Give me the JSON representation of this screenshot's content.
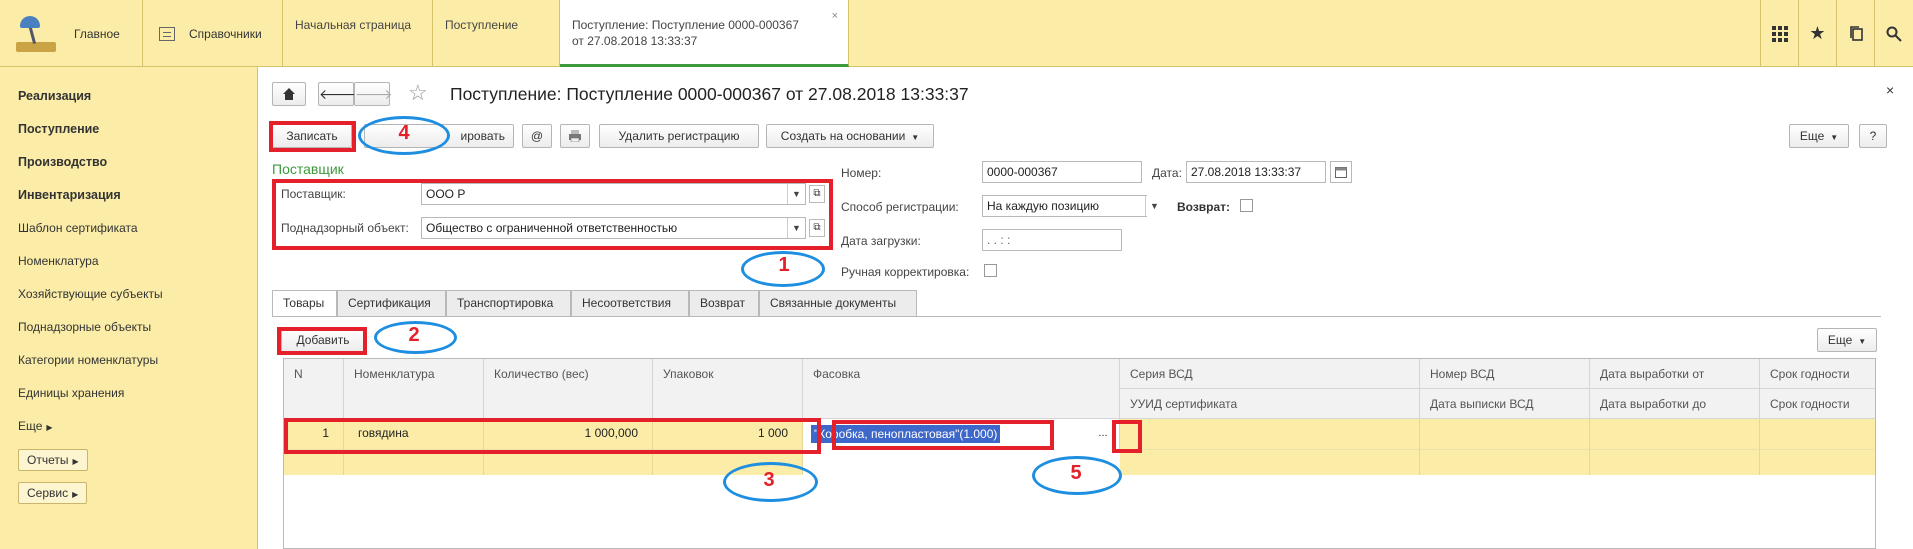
{
  "topbar": {
    "home_label": "Главное",
    "catalogs_label": "Справочники",
    "tabs": [
      {
        "label": "Начальная страница"
      },
      {
        "label": "Поступление"
      },
      {
        "label_line1": "Поступление: Поступление 0000-000367",
        "label_line2": "от 27.08.2018 13:33:37",
        "close": "×"
      }
    ],
    "icons": {
      "apps": "grid-icon",
      "favorites": "star-icon",
      "history": "copy-icon",
      "search": "search-icon"
    }
  },
  "sidebar": {
    "items": [
      {
        "label": "Реализация",
        "bold": true
      },
      {
        "label": "Поступление",
        "bold": true
      },
      {
        "label": "Производство",
        "bold": true
      },
      {
        "label": "Инвентаризация",
        "bold": true
      },
      {
        "label": "Шаблон сертификата"
      },
      {
        "label": "Номенклатура"
      },
      {
        "label": "Хозяйствующие субъекты"
      },
      {
        "label": "Поднадзорные объекты"
      },
      {
        "label": "Категории номенклатуры"
      },
      {
        "label": "Единицы хранения"
      },
      {
        "label": "Еще"
      }
    ],
    "reports_label": "Отчеты",
    "service_label": "Сервис"
  },
  "document": {
    "title": "Поступление: Поступление 0000-000367 от 27.08.2018 13:33:37",
    "close": "×",
    "toolbar": {
      "save_label": "Записать",
      "print_partial": "ировать",
      "at_label": "@",
      "delete_reg_label": "Удалить регистрацию",
      "create_basis_label": "Создать на основании",
      "more_label": "Еще",
      "help_label": "?"
    },
    "supplier_group_title": "Поставщик",
    "supplier_label": "Поставщик:",
    "supplier_value": "ООО  Р",
    "object_label": "Поднадзорный объект:",
    "object_value": "Общество с ограниченной ответственностью",
    "number_label": "Номер:",
    "number_value": "0000-000367",
    "date_label": "Дата:",
    "date_value": "27.08.2018 13:33:37",
    "reg_method_label": "Способ регистрации:",
    "reg_method_value": "На каждую позицию",
    "return_label": "Возврат:",
    "load_date_label": "Дата загрузки:",
    "load_date_value": " .  .       :  :",
    "manual_label": "Ручная корректировка:"
  },
  "tabs": [
    {
      "label": "Товары"
    },
    {
      "label": "Сертификация"
    },
    {
      "label": "Транспортировка"
    },
    {
      "label": "Несоответствия"
    },
    {
      "label": "Возврат"
    },
    {
      "label": "Связанные документы"
    }
  ],
  "goods": {
    "add_label": "Добавить",
    "more_label": "Еще",
    "columns": {
      "n": "N",
      "nomenclature": "Номенклатура",
      "quantity": "Количество (вес)",
      "packs": "Упаковок",
      "packaging": "Фасовка",
      "vsd_series": "Серия ВСД",
      "cert_uuid": "УУИД сертификата",
      "vsd_number": "Номер ВСД",
      "vsd_date": "Дата выписки ВСД",
      "prod_from": "Дата выработки от",
      "prod_to": "Дата выработки до",
      "shelf_life": "Срок годности",
      "shelf_life2": "Срок годности"
    },
    "rows": [
      {
        "n": "1",
        "nomenclature": "говядина",
        "quantity": "1 000,000",
        "packs": "1 000",
        "packaging": "\"Коробка, пенопластовая\"(1.000)",
        "choose": "..."
      }
    ]
  },
  "annotations": [
    "1",
    "2",
    "3",
    "4",
    "5"
  ]
}
